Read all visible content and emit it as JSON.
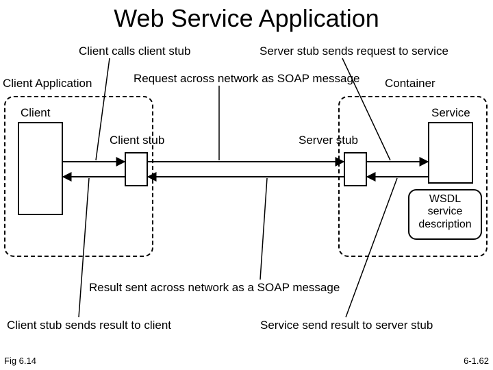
{
  "title": "Web Service Application",
  "annotations": {
    "a1": "Client calls client stub",
    "a2": "Server stub sends request to service",
    "a3": "Request across network as SOAP message",
    "a4": "Result sent across network as a SOAP message",
    "a5": "Client stub sends result to client",
    "a6": "Service send result to server stub"
  },
  "boxLabels": {
    "clientApp": "Client Application",
    "container": "Container",
    "client": "Client",
    "clientStub": "Client stub",
    "serverStub": "Server stub",
    "service": "Service",
    "wsdl_l1": "WSDL",
    "wsdl_l2": "service",
    "wsdl_l3": "description"
  },
  "footer": {
    "left": "Fig 6.14",
    "right": "6-1.62"
  }
}
